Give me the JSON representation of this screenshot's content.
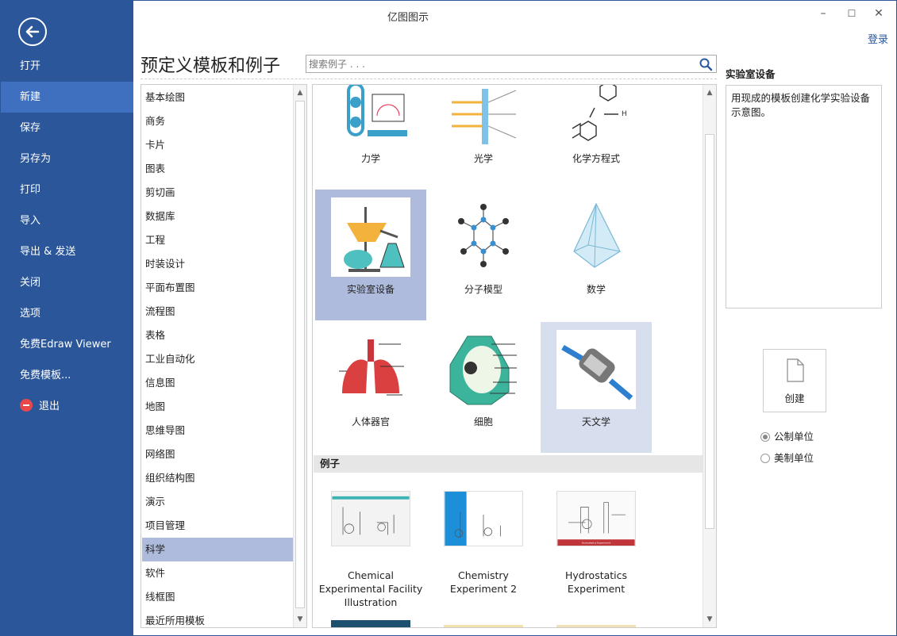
{
  "window": {
    "title": "亿图图示",
    "login": "登录",
    "minimize": "–",
    "maximize": "☐",
    "close": "✕"
  },
  "nav": {
    "items": [
      {
        "label": "打开"
      },
      {
        "label": "新建"
      },
      {
        "label": "保存"
      },
      {
        "label": "另存为"
      },
      {
        "label": "打印"
      },
      {
        "label": "导入"
      },
      {
        "label": "导出 & 发送"
      },
      {
        "label": "关闭"
      },
      {
        "label": "选项"
      },
      {
        "label": "免费Edraw Viewer"
      },
      {
        "label": "免费模板..."
      },
      {
        "label": "退出"
      }
    ],
    "active": "新建"
  },
  "header": {
    "title": "预定义模板和例子",
    "search_placeholder": "搜索例子 . . ."
  },
  "categories": [
    "基本绘图",
    "商务",
    "卡片",
    "图表",
    "剪切画",
    "数据库",
    "工程",
    "时装设计",
    "平面布置图",
    "流程图",
    "表格",
    "工业自动化",
    "信息图",
    "地图",
    "思维导图",
    "网络图",
    "组织结构图",
    "演示",
    "项目管理",
    "科学",
    "软件",
    "线框图",
    "最近所用模板"
  ],
  "selected_category": "科学",
  "templates": [
    {
      "label": "力学"
    },
    {
      "label": "光学"
    },
    {
      "label": "化学方程式"
    },
    {
      "label": "实验室设备"
    },
    {
      "label": "分子模型"
    },
    {
      "label": "数学"
    },
    {
      "label": "人体器官"
    },
    {
      "label": "细胞"
    },
    {
      "label": "天文学"
    }
  ],
  "examples_header": "例子",
  "examples": [
    {
      "label": "Chemical Experimental Facility Illustration"
    },
    {
      "label": "Chemistry Experiment 2"
    },
    {
      "label": "Hydrostatics Experiment"
    }
  ],
  "example_banner": "Hydrostatics Experiment",
  "panel": {
    "title": "实验室设备",
    "description": "用现成的模板创建化学实验设备示意图。",
    "create_label": "创建",
    "units": [
      {
        "label": "公制单位",
        "checked": true
      },
      {
        "label": "美制单位",
        "checked": false
      }
    ]
  },
  "colors": {
    "nav": "#2b579a",
    "nav_active": "#3f6fbf",
    "selected": "#aebbdc",
    "exit": "#e8474b"
  }
}
